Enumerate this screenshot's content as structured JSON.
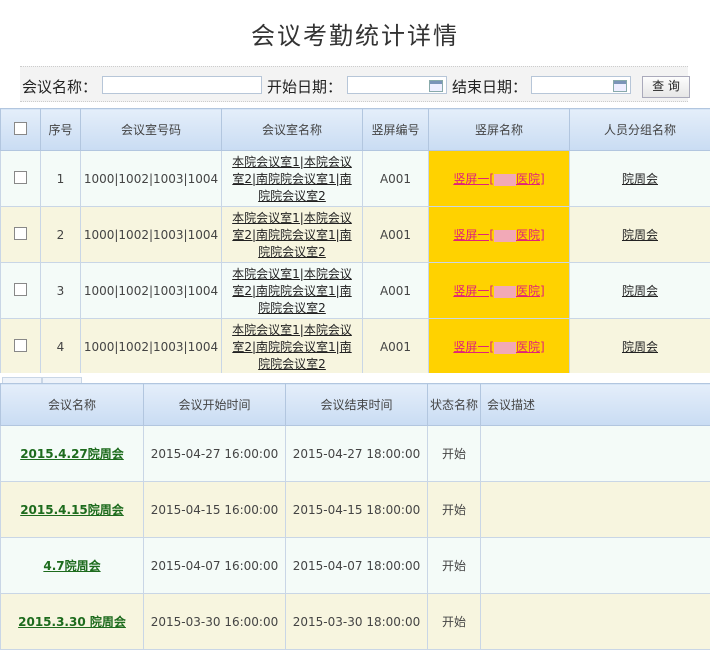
{
  "page": {
    "title": "会议考勤统计详情"
  },
  "search": {
    "meeting_name_label": "会议名称：",
    "meeting_name_value": "",
    "start_date_label": "开始日期：",
    "start_date_value": "",
    "end_date_label": "结束日期：",
    "end_date_value": "",
    "search_button": "查 询"
  },
  "screen_table": {
    "headers": [
      "序号",
      "会议室号码",
      "会议室名称",
      "竖屏编号",
      "竖屏名称",
      "人员分组名称"
    ],
    "rows": [
      {
        "no": "1",
        "room_numbers": "1000|1002|1003|1004",
        "room_names": "本院会议室1|本院会议室2|南院院会议室1|南院院会议室2",
        "screen_no": "A001",
        "screen_name_prefix": "竖屏一[",
        "screen_name_suffix": "医院]",
        "group_name": "院周会"
      },
      {
        "no": "2",
        "room_numbers": "1000|1002|1003|1004",
        "room_names": "本院会议室1|本院会议室2|南院院会议室1|南院院会议室2",
        "screen_no": "A001",
        "screen_name_prefix": "竖屏一[",
        "screen_name_suffix": "医院]",
        "group_name": "院周会"
      },
      {
        "no": "3",
        "room_numbers": "1000|1002|1003|1004",
        "room_names": "本院会议室1|本院会议室2|南院院会议室1|南院院会议室2",
        "screen_no": "A001",
        "screen_name_prefix": "竖屏一[",
        "screen_name_suffix": "医院]",
        "group_name": "院周会"
      },
      {
        "no": "4",
        "room_numbers": "1000|1002|1003|1004",
        "room_names": "本院会议室1|本院会议室2|南院院会议室1|南院院会议室2",
        "screen_no": "A001",
        "screen_name_prefix": "竖屏一[",
        "screen_name_suffix": "医院]",
        "group_name": "院周会"
      }
    ]
  },
  "meeting_table": {
    "headers": [
      "会议名称",
      "会议开始时间",
      "会议结束时间",
      "状态名称",
      "会议描述"
    ],
    "rows": [
      {
        "name": "2015.4.27院周会",
        "start": "2015-04-27 16:00:00",
        "end": "2015-04-27 18:00:00",
        "status": "开始",
        "desc": ""
      },
      {
        "name": "2015.4.15院周会",
        "start": "2015-04-15 16:00:00",
        "end": "2015-04-15 18:00:00",
        "status": "开始",
        "desc": ""
      },
      {
        "name": "4.7院周会",
        "start": "2015-04-07 16:00:00",
        "end": "2015-04-07 18:00:00",
        "status": "开始",
        "desc": ""
      },
      {
        "name": "2015.3.30 院周会",
        "start": "2015-03-30 16:00:00",
        "end": "2015-03-30 18:00:00",
        "status": "开始",
        "desc": ""
      }
    ]
  },
  "colors": {
    "highlight": "#ffd200",
    "link_pink": "#e0217a",
    "link_green": "#1d6b1d",
    "row_odd": "#f4fbf8",
    "row_even": "#f7f5df"
  }
}
